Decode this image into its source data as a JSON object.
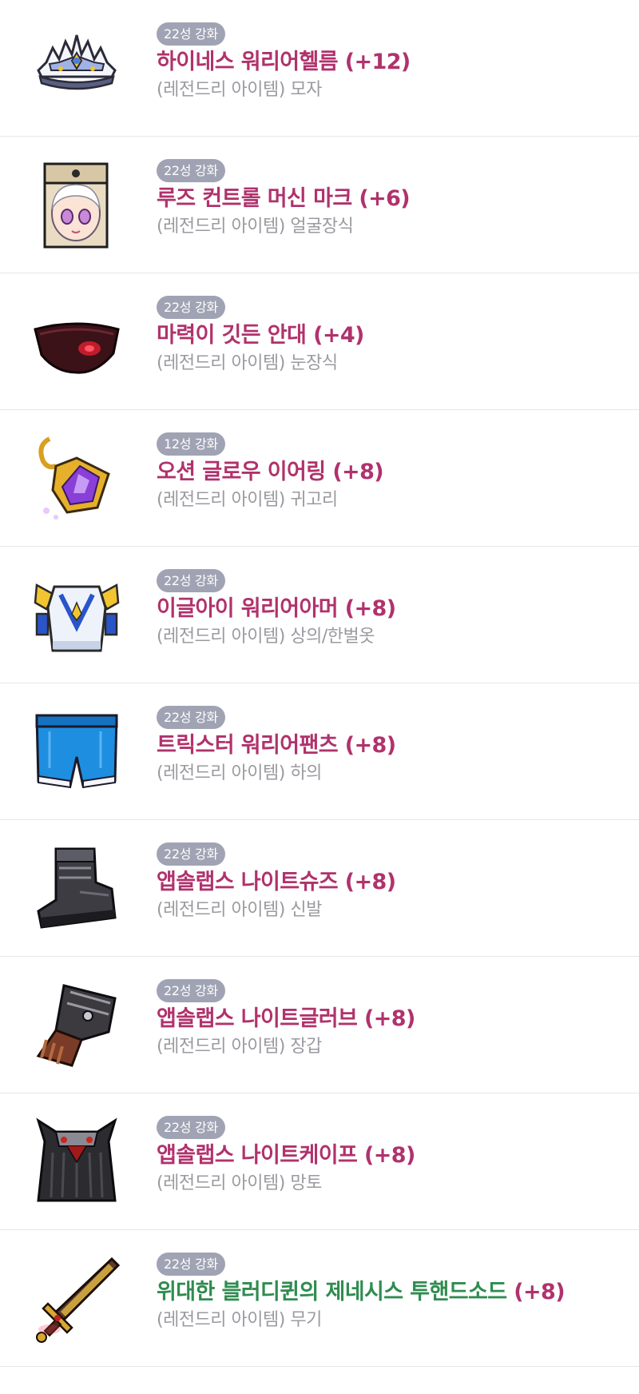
{
  "items": [
    {
      "badge": "22성 강화",
      "name": "하이네스 워리어헬름 (+12)",
      "grade": "(레전드리 아이템)",
      "slot": "모자",
      "icon": "helmet-icon"
    },
    {
      "badge": "22성 강화",
      "name": "루즈 컨트롤 머신 마크 (+6)",
      "grade": "(레전드리 아이템)",
      "slot": "얼굴장식",
      "icon": "face-mark-icon"
    },
    {
      "badge": "22성 강화",
      "name": "마력이 깃든 안대 (+4)",
      "grade": "(레전드리 아이템)",
      "slot": "눈장식",
      "icon": "eyepatch-icon"
    },
    {
      "badge": "12성 강화",
      "name": "오션 글로우 이어링 (+8)",
      "grade": "(레전드리 아이템)",
      "slot": "귀고리",
      "icon": "earring-icon"
    },
    {
      "badge": "22성 강화",
      "name": "이글아이 워리어아머 (+8)",
      "grade": "(레전드리 아이템)",
      "slot": "상의/한벌옷",
      "icon": "armor-icon"
    },
    {
      "badge": "22성 강화",
      "name": "트릭스터 워리어팬츠 (+8)",
      "grade": "(레전드리 아이템)",
      "slot": "하의",
      "icon": "pants-icon"
    },
    {
      "badge": "22성 강화",
      "name": "앱솔랩스 나이트슈즈 (+8)",
      "grade": "(레전드리 아이템)",
      "slot": "신발",
      "icon": "boots-icon"
    },
    {
      "badge": "22성 강화",
      "name": "앱솔랩스 나이트글러브 (+8)",
      "grade": "(레전드리 아이템)",
      "slot": "장갑",
      "icon": "glove-icon"
    },
    {
      "badge": "22성 강화",
      "name": "앱솔랩스 나이트케이프 (+8)",
      "grade": "(레전드리 아이템)",
      "slot": "망토",
      "icon": "cape-icon"
    },
    {
      "badge": "22성 강화",
      "name_main": "위대한 블러디퀸의 제네시스 투핸드소드",
      "name_enh": "(+8)",
      "grade": "(레전드리 아이템)",
      "slot": "무기",
      "icon": "sword-icon"
    }
  ],
  "colors": {
    "badge_bg": "#a0a3b3",
    "name": "#b0326c",
    "genesis_name": "#2f8c4f",
    "sub": "#9a9aa0",
    "divider": "#e7e7ea"
  }
}
